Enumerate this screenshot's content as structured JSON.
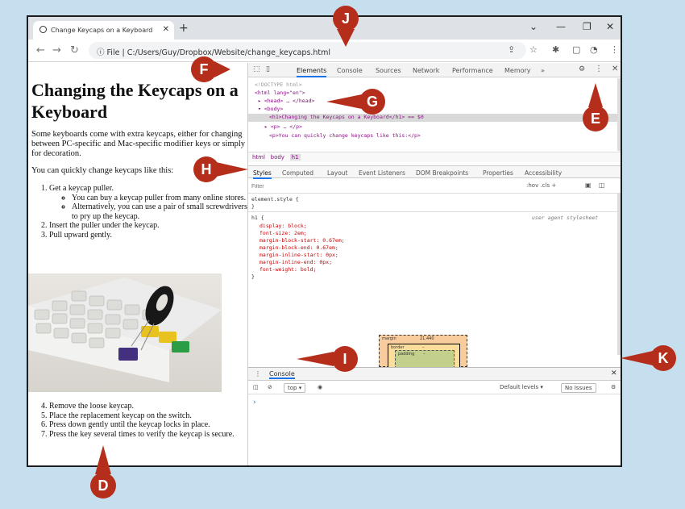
{
  "browser": {
    "tab_title": "Change Keycaps on a Keyboard",
    "new_tab": "+",
    "url_prefix": "File",
    "url": "C:/Users/Guy/Dropbox/Website/change_keycaps.html"
  },
  "page": {
    "title": "Changing the Keycaps on a Keyboard",
    "intro": "Some keyboards come with extra keycaps, either for changing between PC-specific and Mac-specific modifier keys or simply for decoration.",
    "lead": "You can quickly change keycaps like this:",
    "steps_a": [
      "Get a keycap puller.",
      "Insert the puller under the keycap.",
      "Pull upward gently."
    ],
    "substeps": [
      "You can buy a keycap puller from many online stores.",
      "Alternatively, you can use a pair of small screwdrivers to pry up the keycap."
    ],
    "steps_b": [
      "Remove the loose keycap.",
      "Place the replacement keycap on the switch.",
      "Press down gently until the keycap locks in place.",
      "Press the key several times to verify the keycap is secure."
    ]
  },
  "devtools": {
    "tabs": [
      "Elements",
      "Console",
      "Sources",
      "Network",
      "Performance",
      "Memory",
      "»"
    ],
    "elements": [
      "<!DOCTYPE html>",
      "<html lang=\"en\">",
      "▸ <head> … </head>",
      "▾ <body>",
      "<h1>Changing the Keycaps on a Keyboard</h1> == $0",
      "▸ <p> … </p>",
      "<p>You can quickly change keycaps like this:</p>"
    ],
    "breadcrumbs": [
      "html",
      "body",
      "h1"
    ],
    "subtabs": [
      "Styles",
      "Computed",
      "Layout",
      "Event Listeners",
      "DOM Breakpoints",
      "Properties",
      "Accessibility"
    ],
    "filter_placeholder": "Filter",
    "filter_tools": ":hov  .cls  +",
    "element_style": "element.style {",
    "close_brace": "}",
    "h1_rule": "h1 {",
    "user_agent": "user agent stylesheet",
    "rules": [
      "display: block;",
      "font-size: 2em;",
      "margin-block-start: 0.67em;",
      "margin-block-end: 0.67em;",
      "margin-inline-start: 0px;",
      "margin-inline-end: 0px;",
      "font-weight: bold;"
    ],
    "box_model": {
      "margin": "margin",
      "margin_val": "21.440",
      "border": "border",
      "border_val": "–",
      "padding": "padding",
      "padding_val": "–"
    },
    "drawer_tab": "Console",
    "console_top": "top ▾",
    "console_levels": "Default levels ▾",
    "console_issues": "No Issues",
    "prompt": "›"
  },
  "callouts": {
    "D": "D",
    "E": "E",
    "F": "F",
    "G": "G",
    "H": "H",
    "I": "I",
    "J": "J",
    "K": "K"
  },
  "colors": {
    "callout": "#b52e1b",
    "background": "#c6dfee",
    "accent": "#1a73e8"
  }
}
